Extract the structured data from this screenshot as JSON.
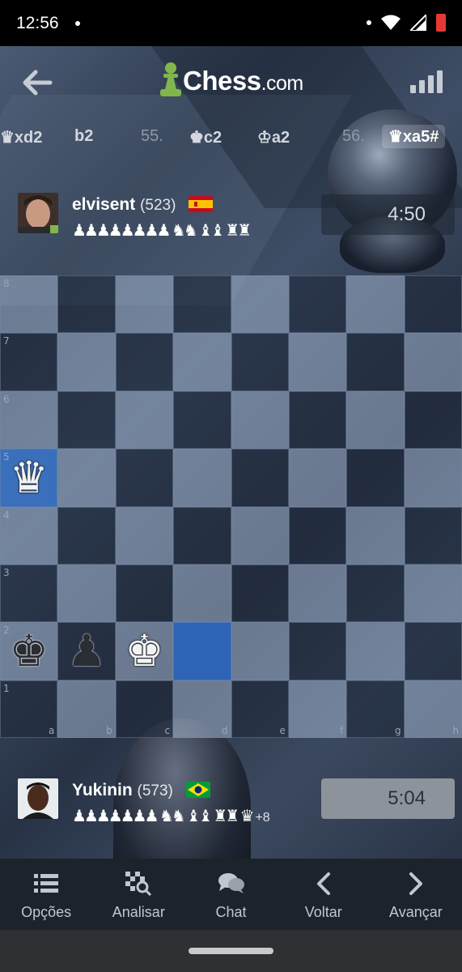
{
  "status_bar": {
    "time": "12:56"
  },
  "header": {
    "logo_main": "Chess",
    "logo_suffix": ".com"
  },
  "moves": [
    {
      "text": "♛xd2",
      "kind": "move"
    },
    {
      "text": "b2",
      "kind": "move"
    },
    {
      "text": "55.",
      "kind": "num"
    },
    {
      "text": "♚c2",
      "kind": "move"
    },
    {
      "text": "♔a2",
      "kind": "move"
    },
    {
      "text": "56.",
      "kind": "num"
    },
    {
      "text": "♛xa5#",
      "kind": "current"
    }
  ],
  "opponent": {
    "name": "elvisent",
    "rating": "(523)",
    "captured": "♟♟♟♟♟♟♟♟ ♞♞ ♝♝ ♜♜",
    "clock": "4:50",
    "flag": "spain"
  },
  "player": {
    "name": "Yukinin",
    "rating": "(573)",
    "captured": "♟♟♟♟♟♟♟ ♞♞ ♝♝ ♜♜ ♛",
    "advantage": "+8",
    "clock": "5:04",
    "flag": "brazil"
  },
  "board": {
    "ranks": [
      "8",
      "7",
      "6",
      "5",
      "4",
      "3",
      "2",
      "1"
    ],
    "files": [
      "a",
      "b",
      "c",
      "d",
      "e",
      "f",
      "g",
      "h"
    ],
    "pieces": {
      "a5": {
        "glyph": "♛",
        "color": "w"
      },
      "a2": {
        "glyph": "♚",
        "color": "b"
      },
      "b2": {
        "glyph": "♟",
        "color": "b"
      },
      "c2": {
        "glyph": "♚",
        "color": "w"
      }
    },
    "highlights": {
      "a5": "hl",
      "d2": "hl2"
    }
  },
  "bottom_nav": [
    {
      "label": "Opções",
      "icon": "list-icon"
    },
    {
      "label": "Analisar",
      "icon": "analysis-icon"
    },
    {
      "label": "Chat",
      "icon": "chat-icon"
    },
    {
      "label": "Voltar",
      "icon": "chevron-left-icon"
    },
    {
      "label": "Avançar",
      "icon": "chevron-right-icon"
    }
  ],
  "colors": {
    "brand_green": "#81b64c",
    "highlight_blue": "#3a6fbc",
    "nav_bg": "#1d232b"
  }
}
